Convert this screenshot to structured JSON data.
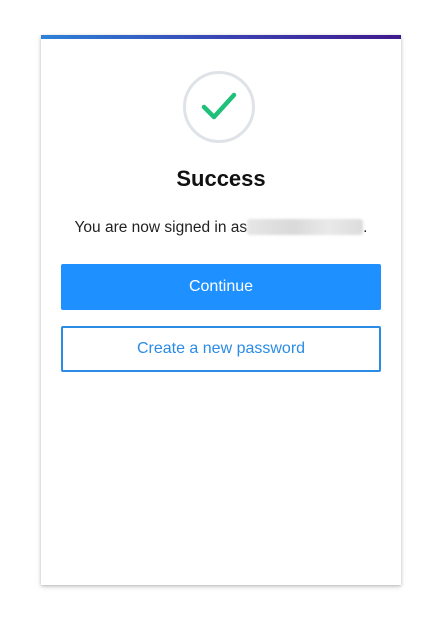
{
  "dialog": {
    "title": "Success",
    "message_prefix": "You are now signed in as",
    "message_suffix": ".",
    "status_icon": "check-icon",
    "check_color": "#1fc07a",
    "accent_gradient": [
      "#2d82d7",
      "#3f1a8c"
    ]
  },
  "actions": {
    "continue_label": "Continue",
    "create_password_label": "Create a new password",
    "primary_color": "#1e90ff"
  }
}
